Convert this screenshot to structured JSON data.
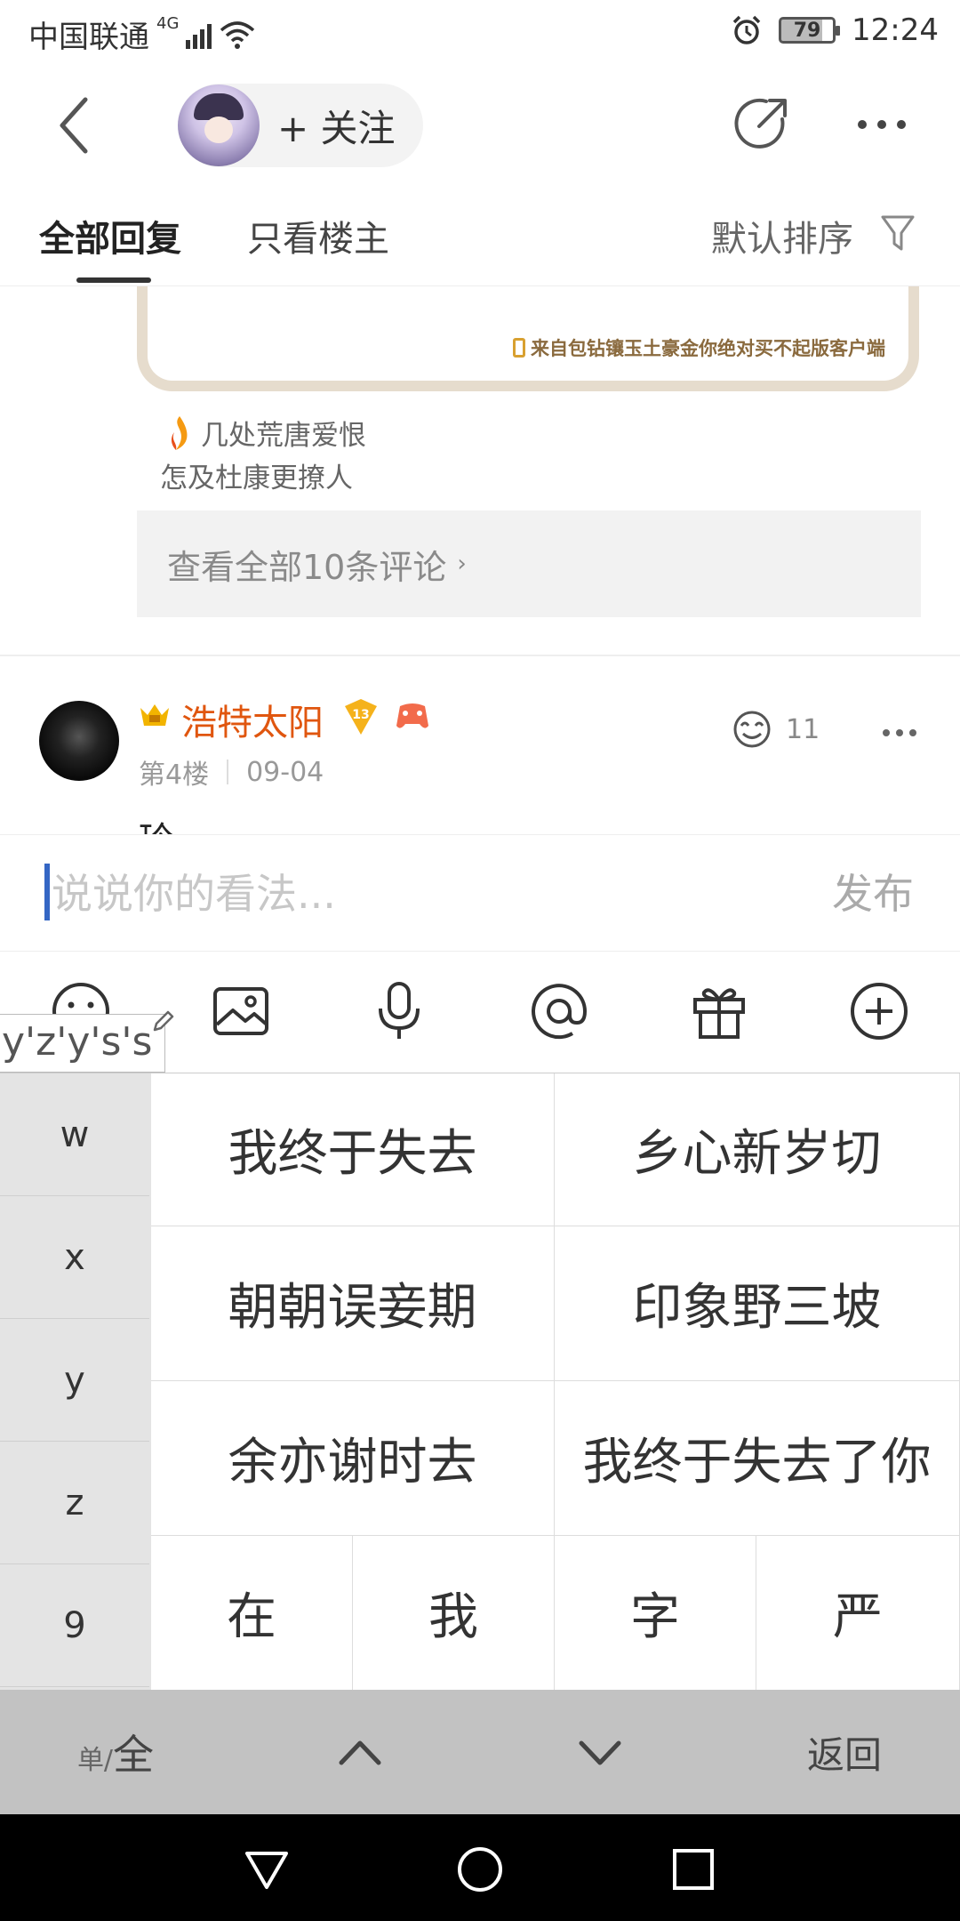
{
  "status_bar": {
    "carrier": "中国联通",
    "network": "4G",
    "battery": "79",
    "time": "12:24"
  },
  "nav": {
    "follow_label": "+ 关注"
  },
  "tabs": {
    "all_replies": "全部回复",
    "owner_only": "只看楼主",
    "sort_label": "默认排序"
  },
  "post": {
    "card_source": "来自包钻镶玉土豪金你绝对买不起版客户端",
    "signature_line1": "几处荒唐爱恨",
    "signature_line2": "怎及杜康更撩人",
    "view_all_comments": "查看全部10条评论",
    "view_all_chevron": "›"
  },
  "reply": {
    "username": "浩特太阳",
    "level": "13",
    "floor": "第4楼",
    "date": "09-04",
    "like_count": "11",
    "preview_text": "玲"
  },
  "composer": {
    "placeholder": "说说你的看法...",
    "publish_label": "发布"
  },
  "toolbar": {
    "icons": [
      "emoji-icon",
      "image-icon",
      "microphone-icon",
      "at-icon",
      "gift-icon",
      "plus-icon"
    ]
  },
  "ime": {
    "composing": "y'z'y's's",
    "left_keys": [
      "w",
      "x",
      "y",
      "z",
      "9"
    ],
    "candidates_wide": [
      "我终于失去",
      "乡心新岁切",
      "朝朝误妾期",
      "印象野三坡",
      "余亦谢时去",
      "我终于失去了你"
    ],
    "candidates_single": [
      "在",
      "我",
      "字",
      "严"
    ],
    "mode_small": "单/",
    "mode_big": "全",
    "back_label": "返回"
  },
  "colors": {
    "accent_orange": "#e0560f",
    "cursor_blue": "#3466c4",
    "card_border": "#e6dccd"
  }
}
